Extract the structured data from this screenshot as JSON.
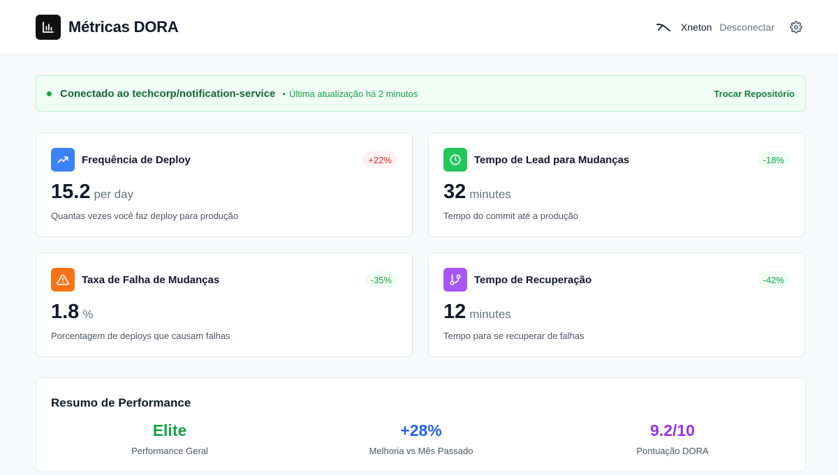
{
  "header": {
    "title": "Métricas DORA",
    "user_name": "Xneton",
    "logout_label": "Desconectar"
  },
  "banner": {
    "connected_text": "Conectado ao techcorp/notification-service",
    "updated_text": "Última atualização há 2 minutos",
    "switch_label": "Trocar Repositório"
  },
  "metrics": [
    {
      "title": "Frequência de Deploy",
      "badge": "+22%",
      "value": "15.2",
      "unit": "per day",
      "description": "Quantas vezes você faz deploy para produção",
      "icon": "trending-up-icon",
      "color": "#3b82f6"
    },
    {
      "title": "Tempo de Lead para Mudanças",
      "badge": "-18%",
      "value": "32",
      "unit": "minutes",
      "description": "Tempo do commit até a produção",
      "icon": "clock-icon",
      "color": "#22c55e"
    },
    {
      "title": "Taxa de Falha de Mudanças",
      "badge": "-35%",
      "value": "1.8",
      "unit": "%",
      "description": "Porcentagem de deploys que causam falhas",
      "icon": "warning-icon",
      "color": "#f97316"
    },
    {
      "title": "Tempo de Recuperação",
      "badge": "-42%",
      "value": "12",
      "unit": "minutes",
      "description": "Tempo para se recuperar de falhas",
      "icon": "git-branch-icon",
      "color": "#a855f7"
    }
  ],
  "summary": {
    "title": "Resumo de Performance",
    "stats": [
      {
        "value": "Elite",
        "label": "Performance Geral",
        "color": "#16a34a"
      },
      {
        "value": "+28%",
        "label": "Melhoria vs Mês Passado",
        "color": "#2563eb"
      },
      {
        "value": "9.2/10",
        "label": "Pontuação DORA",
        "color": "#9333ea"
      }
    ]
  }
}
